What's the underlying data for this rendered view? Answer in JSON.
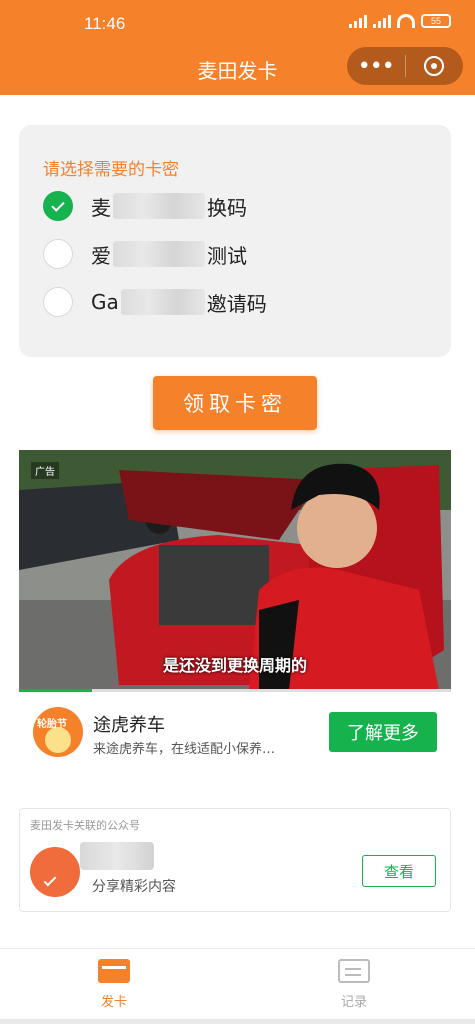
{
  "status_bar": {
    "time": "11:46",
    "battery": "55"
  },
  "header": {
    "title": "麦田发卡",
    "more_icon": "more-dots-icon",
    "close_icon": "target-close-icon"
  },
  "selector": {
    "title": "请选择需要的卡密",
    "options": [
      {
        "prefix": "麦",
        "suffix": "换码",
        "checked": true
      },
      {
        "prefix": "爱",
        "suffix": "测试",
        "checked": false
      },
      {
        "prefix": "Ga",
        "suffix": "邀请码",
        "checked": false
      }
    ]
  },
  "get_button": "领取卡密",
  "ad": {
    "tag": "广告",
    "caption": "是还没到更换周期的",
    "progress": 0.17,
    "name": "途虎养车",
    "description": "来途虎养车，在线适配小保养…",
    "logo_text": "轮胎节",
    "cta": "了解更多"
  },
  "official_account": {
    "header": "麦田发卡关联的公众号",
    "subtitle": "分享精彩内容",
    "button": "查看"
  },
  "tabbar": {
    "tabs": [
      {
        "label": "发卡",
        "icon": "card-icon",
        "active": true
      },
      {
        "label": "记录",
        "icon": "records-icon",
        "active": false
      }
    ]
  },
  "colors": {
    "accent": "#f5812a",
    "green": "#15b24e"
  }
}
